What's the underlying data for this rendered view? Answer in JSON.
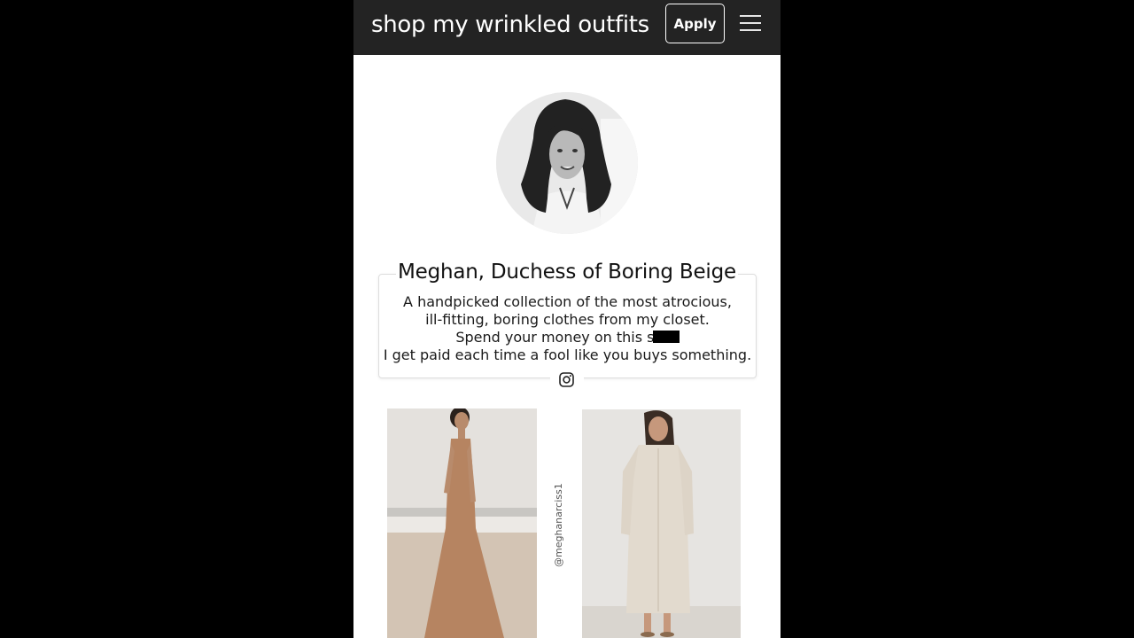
{
  "header": {
    "title": "shop my wrinkled outfits",
    "apply_label": "Apply"
  },
  "profile": {
    "name": "Meghan, Duchess of Boring Beige",
    "description_lines": [
      "A handpicked collection of the most atrocious,",
      "ill-fitting, boring clothes from my closet.",
      "Spend your money on this sh",
      "I get paid each time a fool like you buys something."
    ]
  },
  "gallery": {
    "watermark": "@meghanarciss1"
  },
  "icons": {
    "menu": "hamburger-menu-icon",
    "social": "instagram-icon"
  },
  "colors": {
    "header_bg": "#232323",
    "page_bg": "#ffffff",
    "outer_bg": "#000000"
  }
}
